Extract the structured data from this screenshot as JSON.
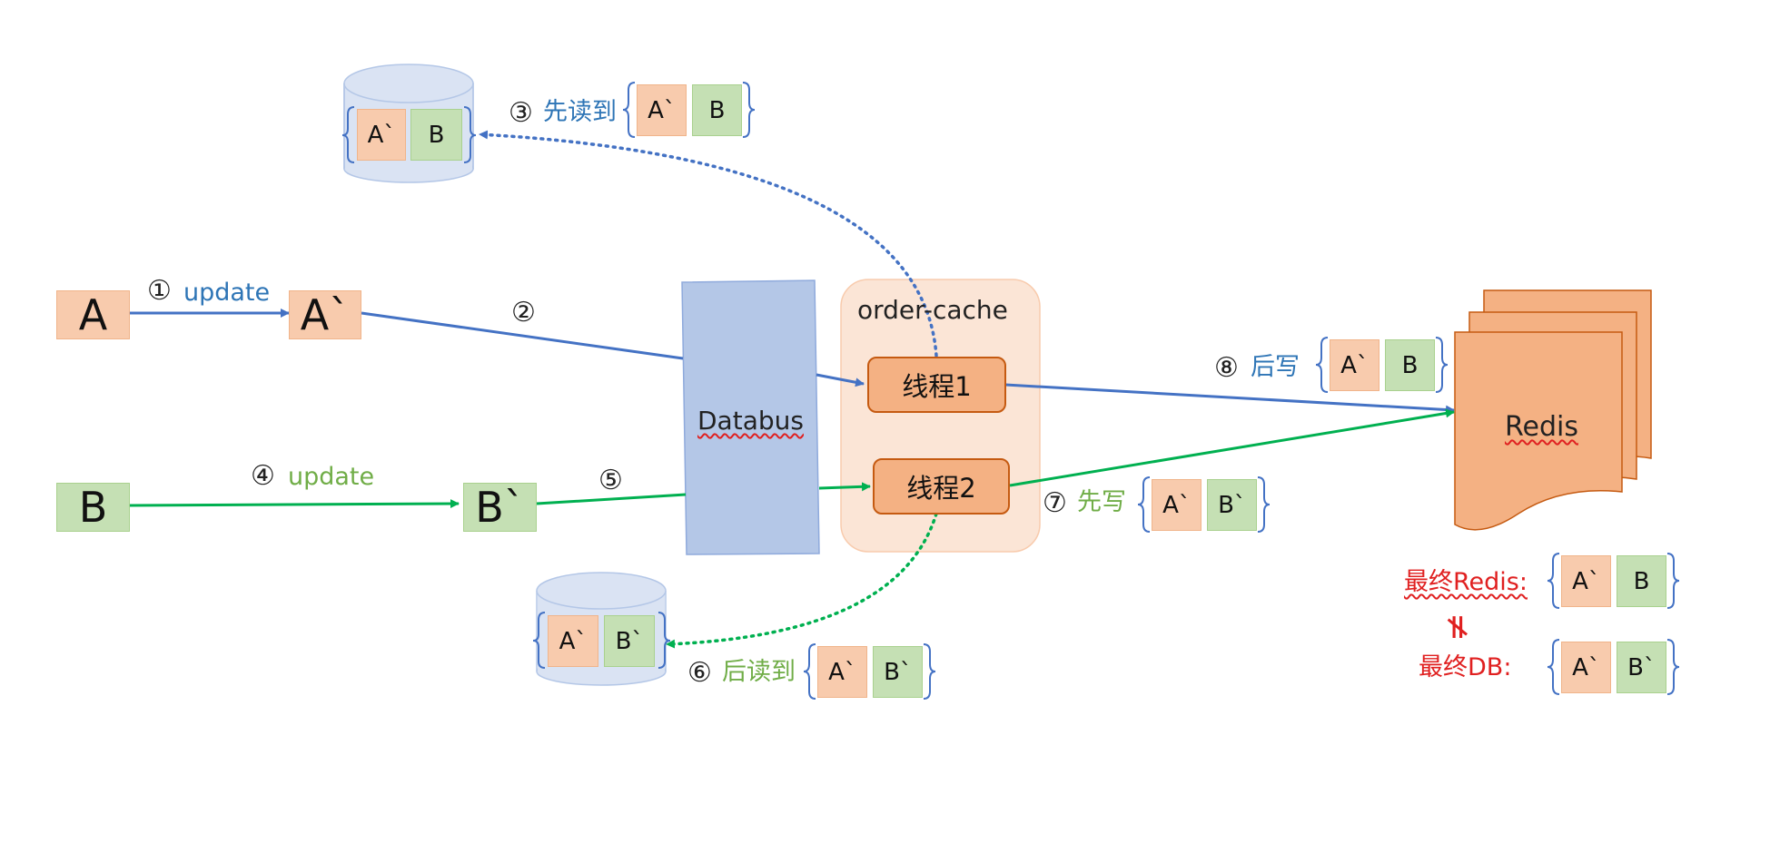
{
  "nodes": {
    "a": "A",
    "a_prime": "A`",
    "b": "B",
    "b_prime": "B`",
    "databus": "Databus",
    "order_cache": "order-cache",
    "thread1": "线程1",
    "thread2": "线程2",
    "redis": "Redis"
  },
  "steps": {
    "s1_num": "①",
    "s1_text": "update",
    "s2_num": "②",
    "s3_num": "③",
    "s3_text": "先读到",
    "s4_num": "④",
    "s4_text": "update",
    "s5_num": "⑤",
    "s6_num": "⑥",
    "s6_text": "后读到",
    "s7_num": "⑦",
    "s7_text": "先写",
    "s8_num": "⑧",
    "s8_text": "后写"
  },
  "db1": {
    "left": "A`",
    "right": "B"
  },
  "db2": {
    "left": "A`",
    "right": "B`"
  },
  "set_read_first": {
    "left": "A`",
    "right": "B"
  },
  "set_read_later": {
    "left": "A`",
    "right": "B`"
  },
  "set_write_first": {
    "left": "A`",
    "right": "B`"
  },
  "set_write_later": {
    "left": "A`",
    "right": "B"
  },
  "final": {
    "redis_label": "最终Redis:",
    "redis_left": "A`",
    "redis_right": "B",
    "not_equal": "≠",
    "db_label": "最终DB:",
    "db_left": "A`",
    "db_right": "B`"
  },
  "colors": {
    "blue_arrow": "#4472c4",
    "green_arrow": "#00b050",
    "orange_fill": "#f8cbad",
    "green_fill": "#c5e0b4",
    "databus_fill": "#b4c7e7",
    "cache_fill": "#fbe5d6",
    "thread_fill": "#f4b183",
    "redis_fill": "#f4b183",
    "final_red": "#e02020"
  }
}
